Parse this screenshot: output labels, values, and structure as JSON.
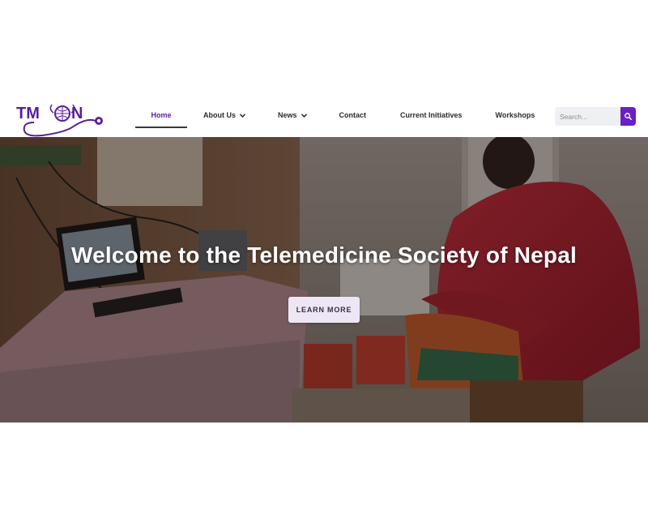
{
  "logo": {
    "text": "TM  N",
    "icon": "stethoscope-globe-logo",
    "color": "#5a1e9c"
  },
  "nav": {
    "items": [
      {
        "label": "Home",
        "active": true,
        "has_dropdown": false
      },
      {
        "label": "About Us",
        "active": false,
        "has_dropdown": true
      },
      {
        "label": "News",
        "active": false,
        "has_dropdown": true
      },
      {
        "label": "Contact",
        "active": false,
        "has_dropdown": false
      },
      {
        "label": "Current Initiatives",
        "active": false,
        "has_dropdown": false
      },
      {
        "label": "Workshops",
        "active": false,
        "has_dropdown": false
      }
    ]
  },
  "search": {
    "placeholder": "Search...",
    "value": "",
    "icon": "search-icon",
    "button_color": "#6b1fc4"
  },
  "hero": {
    "title": "Welcome to the Telemedicine Society of Nepal",
    "button_label": "LEARN MORE",
    "image": "woman-in-red-jacket-at-telemedicine-station"
  },
  "colors": {
    "accent": "#5a1e9c",
    "button_bg": "#ede7f5"
  }
}
